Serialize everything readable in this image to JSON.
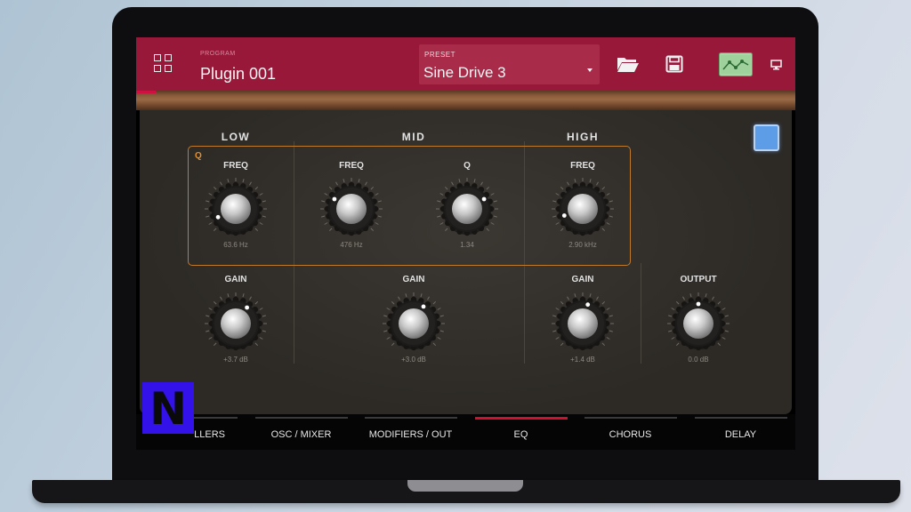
{
  "header": {
    "program_label": "PROGRAM",
    "program_name": "Plugin 001",
    "preset_label": "PRESET",
    "preset_name": "Sine Drive 3"
  },
  "icons": [
    "grid-icon",
    "folder-open-icon",
    "save-icon",
    "eq-curve-icon",
    "screen-icon",
    "chevron-down-icon"
  ],
  "bands": {
    "low": "LOW",
    "mid": "MID",
    "high": "HIGH"
  },
  "q_label": "Q",
  "knobs": {
    "low_freq": {
      "label": "FREQ",
      "value": "63.6 Hz"
    },
    "mid_freq": {
      "label": "FREQ",
      "value": "476 Hz"
    },
    "mid_q": {
      "label": "Q",
      "value": "1.34"
    },
    "high_freq": {
      "label": "FREQ",
      "value": "2.90 kHz"
    },
    "low_gain": {
      "label": "GAIN",
      "value": "+3.7 dB"
    },
    "mid_gain": {
      "label": "GAIN",
      "value": "+3.0 dB"
    },
    "high_gain": {
      "label": "GAIN",
      "value": "+1.4 dB"
    },
    "output": {
      "label": "OUTPUT",
      "value": "0.0 dB"
    }
  },
  "tabs": [
    {
      "label": "CONTROLLERS",
      "visible_label": "LLERS",
      "active": false
    },
    {
      "label": "OSC / MIXER",
      "active": false
    },
    {
      "label": "MODIFIERS / OUT",
      "active": false
    },
    {
      "label": "EQ",
      "active": true
    },
    {
      "label": "CHORUS",
      "active": false
    },
    {
      "label": "DELAY",
      "active": false
    }
  ],
  "overlay_logo": "N",
  "colors": {
    "header": "#98183a",
    "accent": "#d0102e",
    "q_outline": "#c07a2c",
    "power": "#5d9ce6"
  }
}
